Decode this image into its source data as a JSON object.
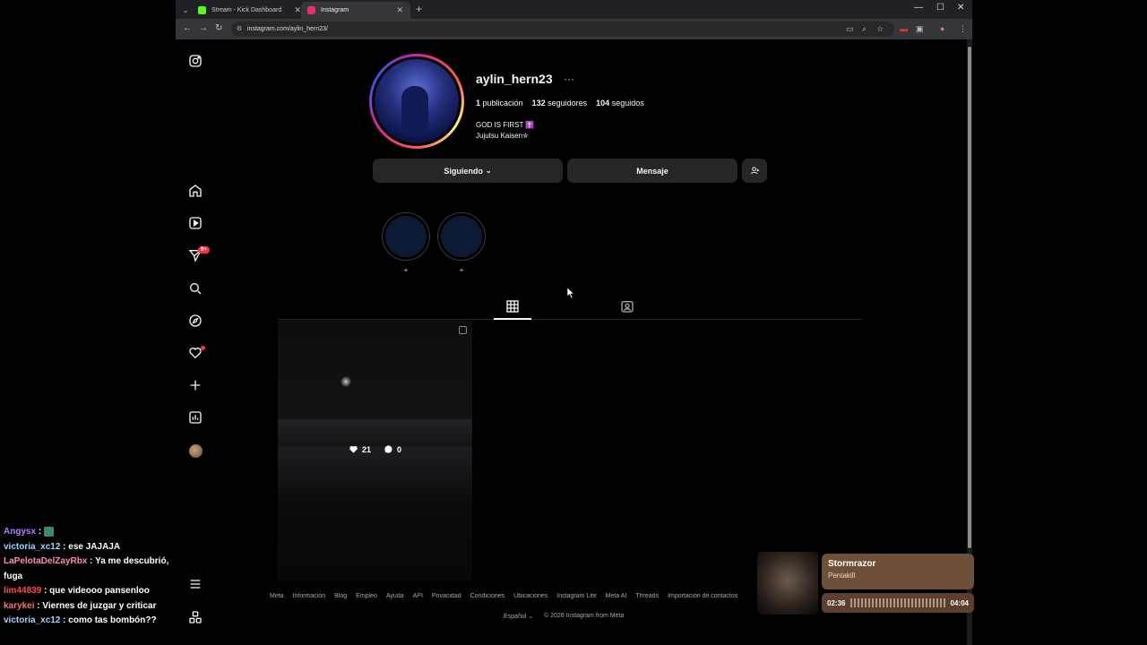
{
  "browser": {
    "tabs": [
      {
        "title": "Stream - Kick Dashboard",
        "fav_color": "#53fc18"
      },
      {
        "title": "Instagram",
        "fav_color": "#e1306c"
      }
    ],
    "url": "instagram.com/aylin_hern23/"
  },
  "sidebar": {
    "notifications_badge": "9+"
  },
  "profile": {
    "username": "aylin_hern23",
    "posts_count": "1",
    "posts_label": "publicación",
    "followers_count": "132",
    "followers_label": "seguidores",
    "following_count": "104",
    "following_label": "seguidos",
    "bio_line1": "GOD IS FIRST ✝️",
    "bio_line2": "Jujutsu Kaisen✮",
    "following_button": "Siguiendo",
    "message_button": "Mensaje"
  },
  "highlights": [
    {
      "label": "+"
    },
    {
      "label": "+"
    }
  ],
  "post": {
    "likes": "21",
    "comments": "0"
  },
  "footer": {
    "links": [
      "Meta",
      "Información",
      "Blog",
      "Empleo",
      "Ayuda",
      "API",
      "Privacidad",
      "Condiciones",
      "Ubicaciones",
      "Instagram Lite",
      "Meta AI",
      "Threads",
      "Importación de contactos"
    ],
    "language": "Español",
    "copyright": "© 2026 Instagram from Meta"
  },
  "chat": [
    {
      "user": "Angysx",
      "color": "#b57bff",
      "message": ""
    },
    {
      "user": "victoria_xc12",
      "color": "#9fd3ff",
      "message": "ese JAJAJA"
    },
    {
      "user": "LaPelotaDelZayRbx",
      "color": "#ff8cb4",
      "message": "Ya me descubrió, fuga"
    },
    {
      "user": "lim44839",
      "color": "#ff4b4b",
      "message": "que videooo pansenloo"
    },
    {
      "user": "karykei",
      "color": "#ff7070",
      "message": "Viernes de juzgar y criticar"
    },
    {
      "user": "victoria_xc12",
      "color": "#9fd3ff",
      "message": "como tas bombón??"
    }
  ],
  "music": {
    "title": "Stormrazor",
    "artist": "Pentakill",
    "elapsed": "02:36",
    "total": "04:04"
  }
}
